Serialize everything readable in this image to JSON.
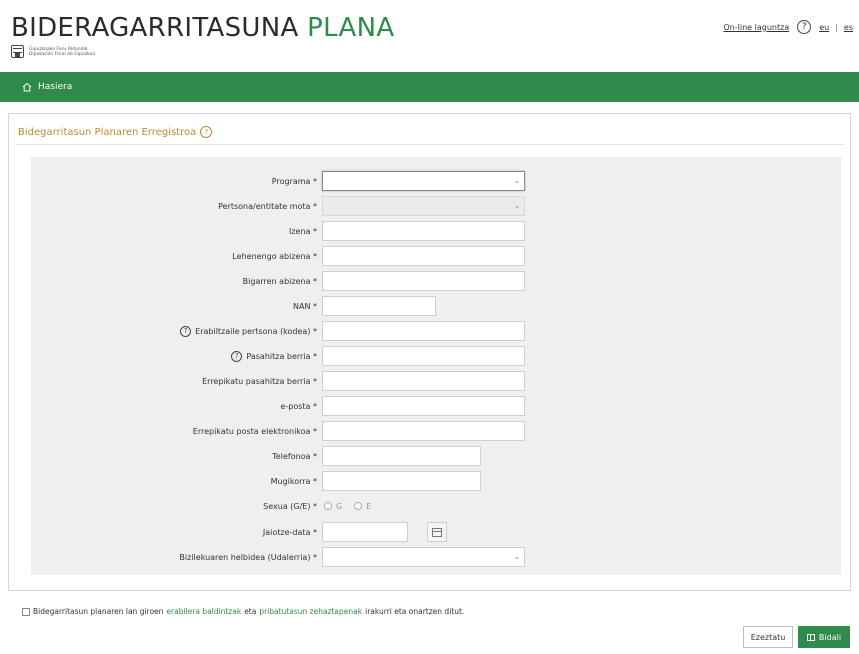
{
  "header": {
    "title_part1": "BIDERAGARRITASUNA",
    "title_part2": "PLANA",
    "logo_line1": "Gipuzkoako Foru Aldundia",
    "logo_line2": "Diputación Foral de Gipuzkoa",
    "help_link": "On-line laguntza",
    "help_icon": "?",
    "lang_eu": "eu",
    "lang_sep": "|",
    "lang_es": "es"
  },
  "nav": {
    "home_label": "Hasiera"
  },
  "panel": {
    "title": "Bidegarritasun Planaren Erregistroa",
    "help_icon": "?"
  },
  "form": {
    "programa": "Programa *",
    "entitate_mota": "Pertsona/entitate mota *",
    "izena": "Izena *",
    "abizena1": "Lehenengo abizena *",
    "abizena2": "Bigarren abizena *",
    "nan": "NAN *",
    "erabiltzaile": "Erabiltzaile pertsona (kodea) *",
    "pasahitza": "Pasahitza berria *",
    "pasahitza_errep": "Errepikatu pasahitza berria *",
    "eposta": "e-posta *",
    "eposta_errep": "Errepikatu posta elektronikoa *",
    "telefonoa": "Telefonoa *",
    "mugikorra": "Mugikorra *",
    "sexua": "Sexua (G/E) *",
    "radio_g": "G",
    "radio_e": "E",
    "jaiotze_data": "Jaiotze-data *",
    "helbidea": "Bizilekuaren helbidea (Udalerria) *",
    "q": "?"
  },
  "footer": {
    "consent_pre": "Bidegarritasun planaren lan giroen",
    "consent_link1": "erabilera baldintzak",
    "consent_mid": "eta",
    "consent_link2": "pribatutasun zehaztapenak",
    "consent_post": "irakurri eta onartzen ditut.",
    "cancel_label": "Ezeztatu",
    "send_label": "Bidali"
  },
  "colors": {
    "brand_green": "#2e8b4b",
    "panel_title": "#c08a2e"
  }
}
